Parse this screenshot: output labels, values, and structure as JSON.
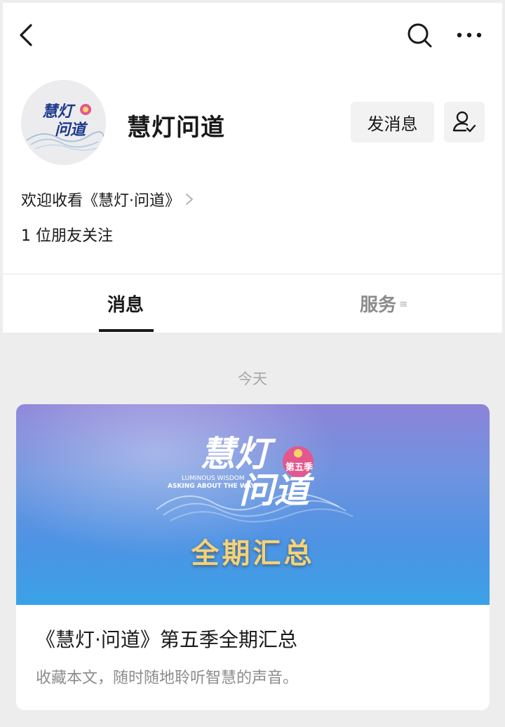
{
  "topbar": {
    "back_icon": "chevron-left-icon",
    "search_icon": "search-icon",
    "more_icon": "more-horizontal-icon"
  },
  "profile": {
    "avatar_text": "慧灯问道",
    "name": "慧灯问道",
    "message_button": "发消息",
    "follow_icon": "user-check-icon",
    "intro": "欢迎收看《慧灯·问道》",
    "friends_following": "1 位朋友关注"
  },
  "tabs": [
    {
      "label": "消息",
      "active": true
    },
    {
      "label": "服务",
      "active": false,
      "menu_glyph": "≡"
    }
  ],
  "feed": {
    "date_label": "今天",
    "article": {
      "cover_logo": "慧灯问道",
      "cover_badge": "第五季",
      "cover_subtitle_1": "LUMINOUS WISDOM",
      "cover_subtitle_2": "ASKING ABOUT THE WAY",
      "cover_title": "全期汇总",
      "title": "《慧灯·问道》第五季全期汇总",
      "description": "收藏本文，随时随地聆听智慧的声音。"
    }
  },
  "colors": {
    "accent_text": "#191919",
    "muted_text": "#8c8c8c",
    "background": "#ededed",
    "cover_title_gold": "#f3d27a"
  }
}
